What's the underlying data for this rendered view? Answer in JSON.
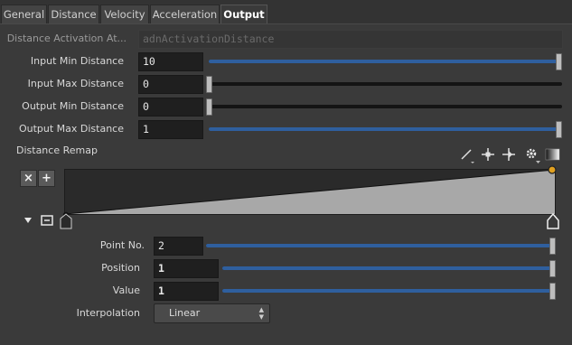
{
  "tabs": [
    {
      "label": "General"
    },
    {
      "label": "Distance"
    },
    {
      "label": "Velocity"
    },
    {
      "label": "Acceleration"
    },
    {
      "label": "Output"
    }
  ],
  "params": {
    "activation_attr": {
      "label": "Distance Activation At...",
      "placeholder": "adnActivationDistance"
    },
    "input_min": {
      "label": "Input Min Distance",
      "value": "10",
      "slider_fraction": 1.0
    },
    "input_max": {
      "label": "Input Max Distance",
      "value": "0",
      "slider_fraction": 0.0
    },
    "output_min": {
      "label": "Output Min Distance",
      "value": "0",
      "slider_fraction": 0.0
    },
    "output_max": {
      "label": "Output Max Distance",
      "value": "1",
      "slider_fraction": 1.0
    }
  },
  "ramp": {
    "label": "Distance Remap",
    "add_label": "+",
    "remove_label": "×",
    "toolbar_icons": [
      "pen-icon",
      "add-point-icon",
      "move-point-icon",
      "gear-icon",
      "gradient-icon"
    ],
    "points": [
      {
        "position": 0,
        "value": 0
      },
      {
        "position": 1,
        "value": 1
      }
    ]
  },
  "point": {
    "point_no": {
      "label": "Point No.",
      "value": "2",
      "slider_fraction": 1.0
    },
    "position": {
      "label": "Position",
      "value": "1",
      "slider_fraction": 1.0
    },
    "value": {
      "label": "Value",
      "value": "1",
      "slider_fraction": 1.0
    },
    "interpolation": {
      "label": "Interpolation",
      "selected": "Linear"
    }
  },
  "colors": {
    "accent": "#2f5f9e",
    "background": "#3a3a3a",
    "field": "#1f1f1f",
    "ramp_fill": "#a8a8a8",
    "selected_point": "#e0a020"
  }
}
